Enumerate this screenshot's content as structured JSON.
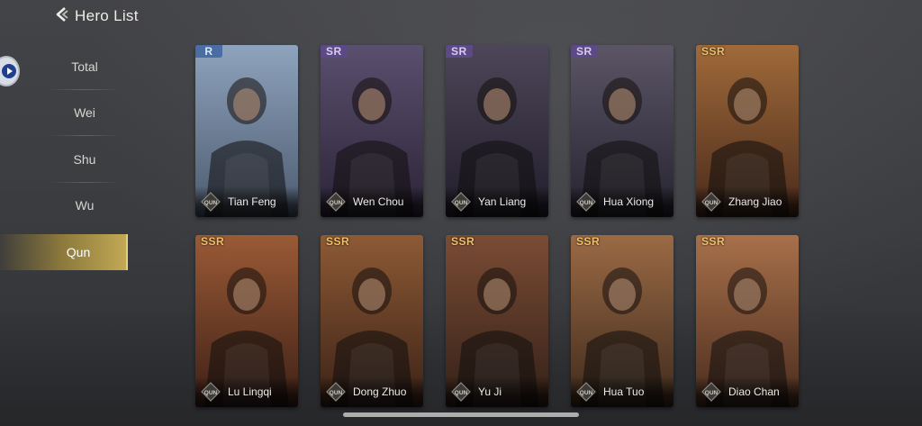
{
  "header": {
    "title": "Hero List"
  },
  "tabs": [
    {
      "label": "Total"
    },
    {
      "label": "Wei"
    },
    {
      "label": "Shu"
    },
    {
      "label": "Wu"
    },
    {
      "label": "Qun",
      "active": true
    }
  ],
  "badge_text": "QUN",
  "heroes": [
    {
      "name": "Tian Feng",
      "rarity": "R",
      "bg": [
        "#8ea3bd",
        "#4c5a6e"
      ]
    },
    {
      "name": "Wen Chou",
      "rarity": "SR",
      "bg": [
        "#5a4f6e",
        "#2c2438"
      ]
    },
    {
      "name": "Yan Liang",
      "rarity": "SR",
      "bg": [
        "#4c4658",
        "#221d2b"
      ]
    },
    {
      "name": "Hua Xiong",
      "rarity": "SR",
      "bg": [
        "#5b5566",
        "#262330"
      ]
    },
    {
      "name": "Zhang Jiao",
      "rarity": "SSR",
      "bg": [
        "#a06a3a",
        "#4a2a1b"
      ]
    },
    {
      "name": "Lu Lingqi",
      "rarity": "SSR",
      "bg": [
        "#9a5a36",
        "#3e2016"
      ]
    },
    {
      "name": "Dong Zhuo",
      "rarity": "SSR",
      "bg": [
        "#8d5a35",
        "#3b2216"
      ]
    },
    {
      "name": "Yu Ji",
      "rarity": "SSR",
      "bg": [
        "#7a4c34",
        "#332018"
      ]
    },
    {
      "name": "Hua Tuo",
      "rarity": "SSR",
      "bg": [
        "#9b6a45",
        "#3e2a1c"
      ]
    },
    {
      "name": "Diao Chan",
      "rarity": "SSR",
      "bg": [
        "#a8704a",
        "#4a2c1e"
      ]
    }
  ]
}
